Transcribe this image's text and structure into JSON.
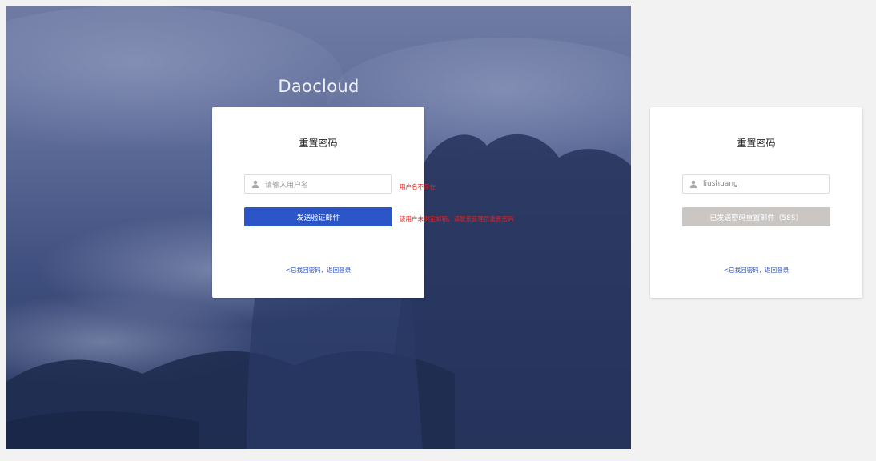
{
  "brand": {
    "title": "Daocloud"
  },
  "left_card": {
    "title": "重置密码",
    "username_placeholder": "请输入用户名",
    "send_button": "发送验证邮件",
    "back_link": "<已找回密码，返回登录",
    "error_username": "用户名不存在",
    "error_email": "该用户未绑定邮箱，请联系管理员重置密码"
  },
  "right_card": {
    "title": "重置密码",
    "username_value": "liushuang",
    "sent_button": "已发送密码重置邮件（58S）",
    "back_link": "<已找回密码，返回登录"
  },
  "colors": {
    "primary": "#2c55c7",
    "disabled": "#c9c6c4",
    "error": "#e02020",
    "link": "#2a4fb8"
  },
  "icons": [
    "user-icon"
  ]
}
